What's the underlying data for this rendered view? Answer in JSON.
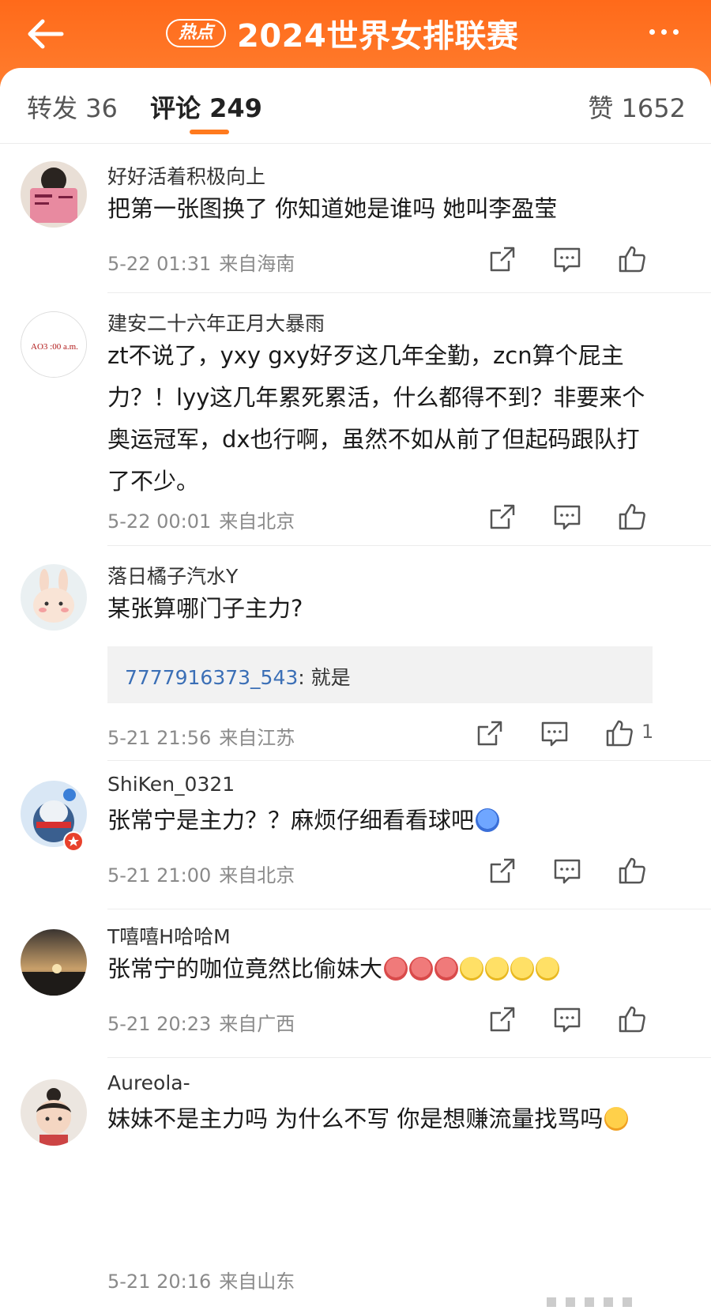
{
  "header": {
    "hot_badge": "热点",
    "title": "2024世界女排联赛",
    "colors": {
      "bg": "#ff6a1a",
      "accent": "#ff7a1e"
    },
    "icons": {
      "back": "back-arrow-icon",
      "more": "more-dots-icon"
    }
  },
  "tabs": {
    "repost": "转发 36",
    "comments": "评论 249",
    "likes": "赞 1652"
  },
  "comments": [
    {
      "username": "好好活着积极向上",
      "text": "把第一张图换了 你知道她是谁吗 她叫李盈莹",
      "date": "5-22 01:31",
      "location": "来自海南"
    },
    {
      "username": "建安二十六年正月大暴雨",
      "avatar_text": "AO3 :00 a.m.",
      "text": "zt不说了，yxy gxy好歹这几年全勤，zcn算个屁主力？！lyy这几年累死累活，什么都得不到？非要来个奥运冠军，dx也行啊，虽然不如从前了但起码跟队打了不少。",
      "date": "5-22 00:01",
      "location": "来自北京"
    },
    {
      "username": "落日橘子汽水Y",
      "text": "某张算哪门子主力?",
      "reply_user": "7777916373_543",
      "reply_text": ": 就是",
      "date": "5-21 21:56",
      "location": "来自江苏",
      "likes": "1"
    },
    {
      "username": "ShiKen_0321",
      "text": "张常宁是主力？？麻烦仔细看看球吧",
      "date": "5-21 21:00",
      "location": "来自北京"
    },
    {
      "username": "T嘻嘻H哈哈M",
      "text": "张常宁的咖位竟然比偷妹大",
      "date": "5-21 20:23",
      "location": "来自广西"
    },
    {
      "username": "Aureola-",
      "text": "妹妹不是主力吗 为什么不写 你是想赚流量找骂吗",
      "date": "5-21 20:16",
      "location": "来自山东"
    }
  ]
}
